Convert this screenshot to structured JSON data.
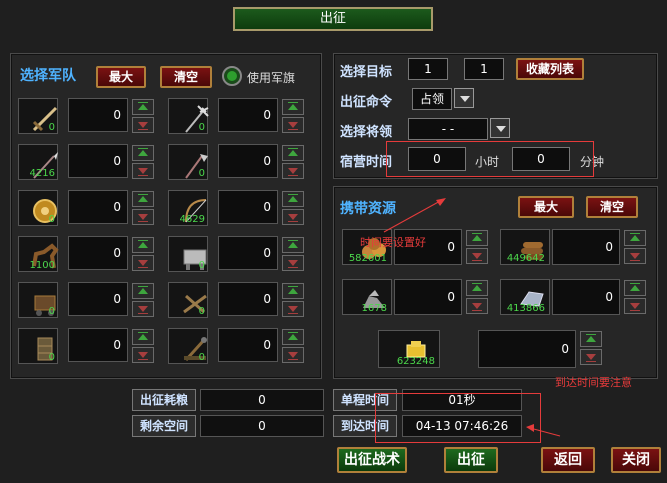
{
  "window": {
    "title": "出征"
  },
  "army": {
    "title": "选择军队",
    "max_label": "最大",
    "clear_label": "清空",
    "use_flag_label": "使用军旗",
    "units": [
      {
        "icon": "sword-icon",
        "count": "0",
        "value": "0"
      },
      {
        "icon": "trident-icon",
        "count": "0",
        "value": "0"
      },
      {
        "icon": "spear-icon",
        "count": "4216",
        "value": "0"
      },
      {
        "icon": "halberd-icon",
        "count": "0",
        "value": "0"
      },
      {
        "icon": "shield-icon",
        "count": "0",
        "value": "0"
      },
      {
        "icon": "bow-icon",
        "count": "4629",
        "value": "0"
      },
      {
        "icon": "horse-icon",
        "count": "1100",
        "value": "0"
      },
      {
        "icon": "armored-horse-icon",
        "count": "0",
        "value": "0"
      },
      {
        "icon": "siege-cart-icon",
        "count": "0",
        "value": "0"
      },
      {
        "icon": "ballista-icon",
        "count": "0",
        "value": "0"
      },
      {
        "icon": "siege-tower-icon",
        "count": "0",
        "value": "0"
      },
      {
        "icon": "catapult-icon",
        "count": "0",
        "value": "0"
      }
    ]
  },
  "target": {
    "label": "选择目标",
    "x": "1",
    "y": "1",
    "favorites_label": "收藏列表",
    "command_label": "出征命令",
    "command_value": "占领",
    "general_label": "选择将领",
    "general_value": "- -",
    "camp_label": "宿营时间",
    "hours": "0",
    "hours_unit": "小时",
    "minutes": "0",
    "minutes_unit": "分钟"
  },
  "resources": {
    "title": "携带资源",
    "max_label": "最大",
    "clear_label": "清空",
    "items": [
      {
        "icon": "grain-icon",
        "count": "582601",
        "value": "0"
      },
      {
        "icon": "wood-icon",
        "count": "449642",
        "value": "0"
      },
      {
        "icon": "stone-icon",
        "count": "1678",
        "value": "0"
      },
      {
        "icon": "iron-icon",
        "count": "413866",
        "value": "0"
      },
      {
        "icon": "gold-icon",
        "count": "623248",
        "value": "0"
      }
    ]
  },
  "stats": {
    "food_label": "出征耗粮",
    "food_value": "0",
    "space_label": "剩余空间",
    "space_value": "0",
    "single_trip_label": "单程时间",
    "single_trip_value": "01秒",
    "arrival_label": "到达时间",
    "arrival_value": "04-13 07:46:26"
  },
  "actions": {
    "tactics": "出征战术",
    "march": "出征",
    "back": "返回",
    "close": "关闭"
  },
  "annotations": {
    "camp_note": "时间要设置好",
    "arrival_note": "到达时间要注意"
  }
}
